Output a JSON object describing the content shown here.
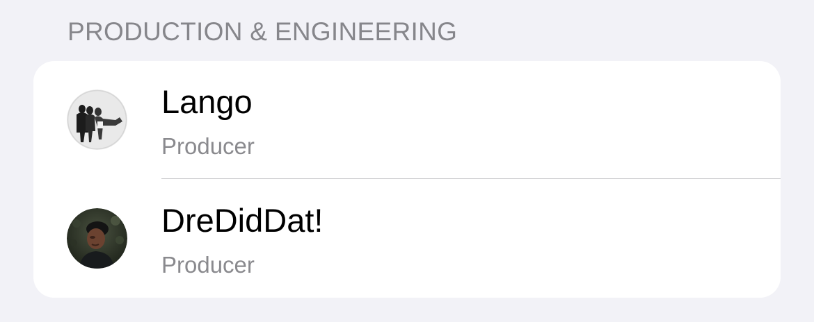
{
  "section": {
    "title": "PRODUCTION & ENGINEERING"
  },
  "credits": [
    {
      "name": "Lango",
      "role": "Producer",
      "avatar": "photo-avatar"
    },
    {
      "name": "DreDidDat!",
      "role": "Producer",
      "avatar": "photo-avatar"
    }
  ],
  "colors": {
    "background": "#f2f2f7",
    "card": "#ffffff",
    "secondary_text": "#8a8a8e",
    "header_text": "#86868b",
    "separator": "#c6c6c8"
  }
}
